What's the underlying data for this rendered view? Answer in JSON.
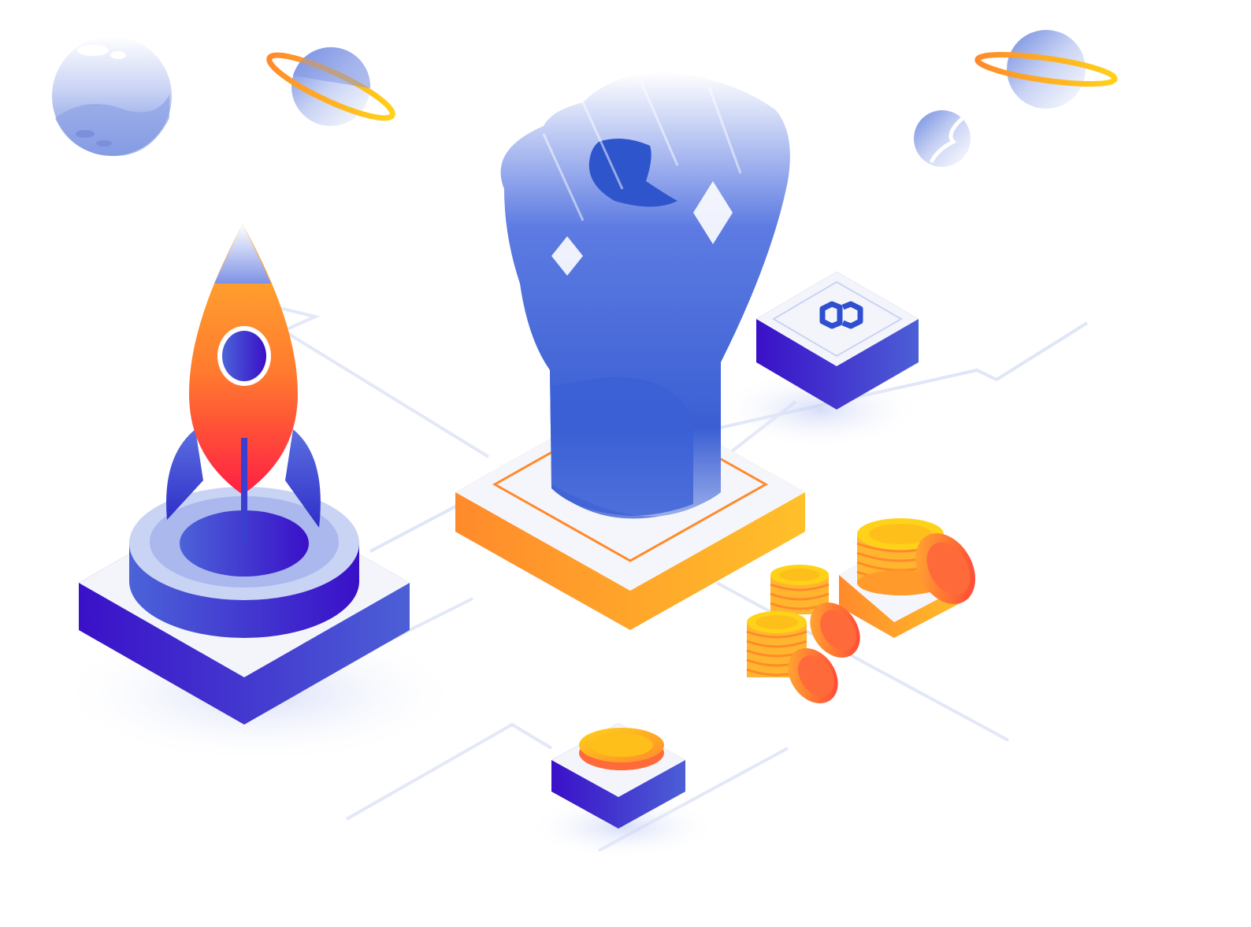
{
  "scene": {
    "description_free": true,
    "logo_mark": "linked-chain-logo"
  },
  "colors": {
    "background": "#ffffff",
    "indigo_dark": "#3a1fc8",
    "blue_mid": "#3f63d8",
    "blue_light": "#8fa6ea",
    "lavender": "#c9d3f4",
    "orange": "#ff8a2b",
    "orange_yellow": "#ffb52e",
    "red": "#ff2d3d",
    "gold": "#ffc400",
    "circuit_line": "#dfe5f7"
  },
  "icons": {
    "planet_left": "moon-planet-icon",
    "saturn_left": "ringed-planet-icon",
    "saturn_right": "ringed-planet-icon",
    "planet_small": "small-planet-icon",
    "rocket": "rocket-icon",
    "fist": "raised-fist-icon",
    "logo_tile": "chain-logo-icon",
    "coins": "coin-stack-icon"
  }
}
